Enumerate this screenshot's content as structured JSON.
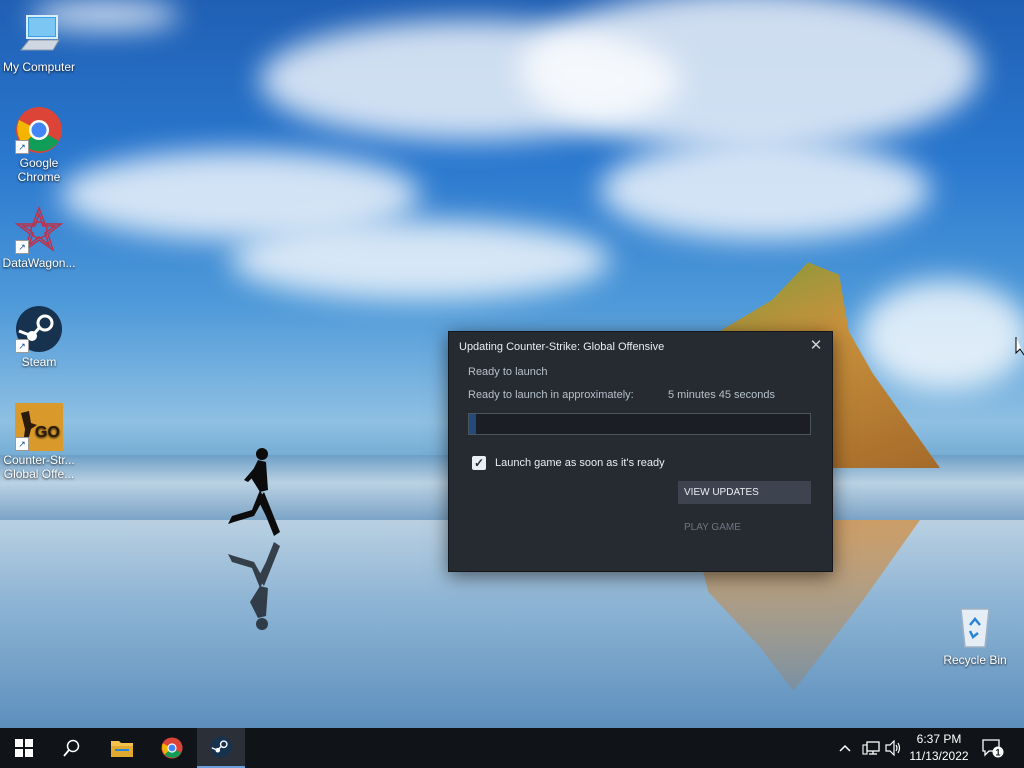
{
  "desktop_icons": [
    {
      "label": "My Computer",
      "icon": "computer-icon"
    },
    {
      "label": "Google Chrome",
      "icon": "chrome-icon"
    },
    {
      "label": "DataWagon...",
      "icon": "datawagon-icon"
    },
    {
      "label": "Steam",
      "icon": "steam-icon"
    },
    {
      "label": "Counter-Str... Global Offe...",
      "icon": "csgo-icon"
    },
    {
      "label": "Recycle Bin",
      "icon": "recycle-bin-icon"
    }
  ],
  "dialog": {
    "title": "Updating Counter-Strike: Global Offensive",
    "close_glyph": "✕",
    "status": "Ready to launch",
    "eta_label": "Ready to launch in approximately:",
    "eta_value": "5 minutes 45 seconds",
    "progress_fraction": 0.02,
    "checkbox_checked": true,
    "checkbox_label": "Launch game as soon as it's ready",
    "view_updates_label": "VIEW UPDATES",
    "play_game_label": "PLAY GAME"
  },
  "taskbar": {
    "buttons": [
      "start-icon",
      "search-icon",
      "file-explorer-icon",
      "chrome-icon",
      "steam-icon"
    ],
    "tray": {
      "time": "6:37 PM",
      "date": "11/13/2022",
      "notification_count": "1"
    }
  },
  "colors": {
    "dialog_bg": "#262a31",
    "taskbar_bg": "#101418",
    "accent": "#6ca0dc"
  }
}
